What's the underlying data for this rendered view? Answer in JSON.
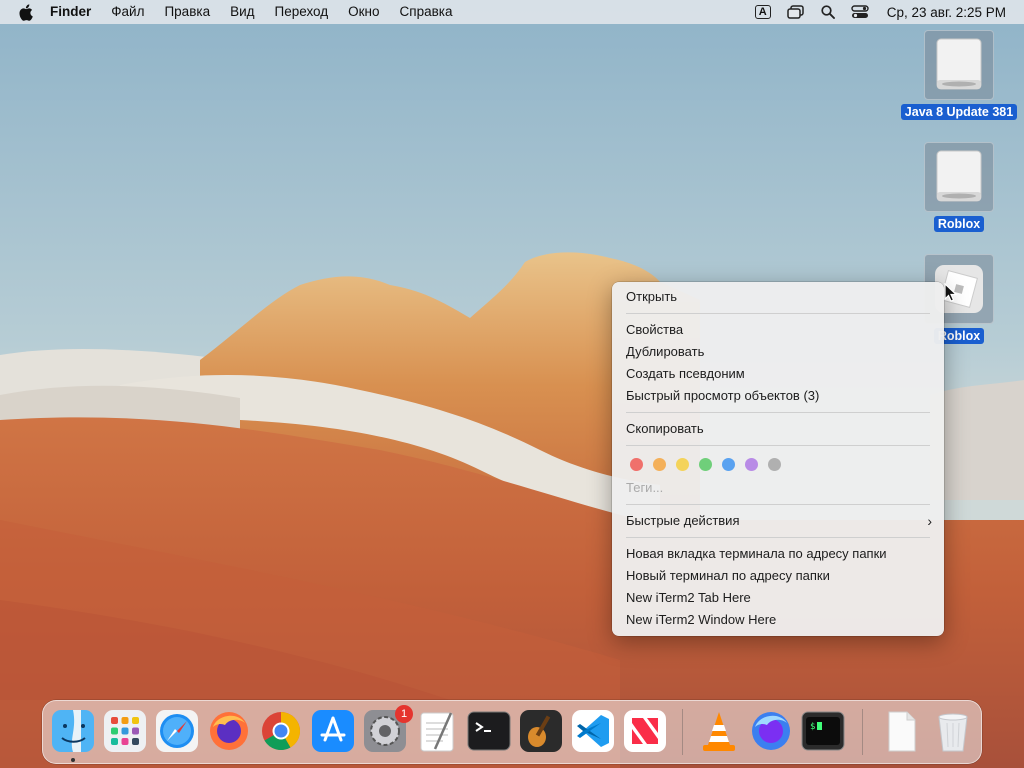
{
  "menubar": {
    "app_name": "Finder",
    "items": [
      "Файл",
      "Правка",
      "Вид",
      "Переход",
      "Окно",
      "Справка"
    ],
    "input_source": "A",
    "clock": "Ср, 23 авг.  2:25 PM",
    "status_icons": [
      "input-source-icon",
      "screen-mirroring-icon",
      "spotlight-search-icon",
      "control-center-icon"
    ]
  },
  "desktop": {
    "icons": [
      {
        "label": "Java 8 Update 381",
        "icon": "disk-image-icon"
      },
      {
        "label": "Roblox",
        "icon": "disk-image-icon"
      },
      {
        "label": "Roblox",
        "icon": "roblox-app-icon"
      }
    ]
  },
  "context_menu": {
    "open": "Открыть",
    "properties": "Свойства",
    "duplicate": "Дублировать",
    "make_alias": "Создать псевдоним",
    "quick_look": "Быстрый просмотр объектов (3)",
    "copy": "Скопировать",
    "tag_colors": [
      "#f0706b",
      "#f4b05a",
      "#f4d35a",
      "#6fcf7a",
      "#5aa2f0",
      "#b88be6",
      "#b0b0b0"
    ],
    "tags_placeholder": "Теги...",
    "quick_actions": "Быстрые действия",
    "new_terminal_tab": "Новая вкладка терминала по адресу папки",
    "new_terminal": "Новый терминал по адресу папки",
    "new_iterm_tab": "New iTerm2 Tab Here",
    "new_iterm_window": "New iTerm2 Window Here"
  },
  "dock": {
    "apps": [
      {
        "name": "finder-icon",
        "running": true
      },
      {
        "name": "launchpad-icon",
        "running": false
      },
      {
        "name": "safari-icon",
        "running": false
      },
      {
        "name": "firefox-icon",
        "running": false
      },
      {
        "name": "chrome-icon",
        "running": false
      },
      {
        "name": "app-store-icon",
        "running": false
      },
      {
        "name": "system-settings-icon",
        "running": false,
        "badge": "1"
      },
      {
        "name": "textedit-icon",
        "running": false
      },
      {
        "name": "terminal-icon",
        "running": false
      },
      {
        "name": "garageband-icon",
        "running": false
      },
      {
        "name": "vscode-icon",
        "running": false
      },
      {
        "name": "news-icon",
        "running": false
      },
      {
        "name": "vlc-icon",
        "running": false
      },
      {
        "name": "firefox-developer-icon",
        "running": false
      },
      {
        "name": "iterm2-icon",
        "running": false
      },
      {
        "name": "document-icon",
        "running": false
      },
      {
        "name": "trash-icon",
        "running": false
      }
    ]
  }
}
